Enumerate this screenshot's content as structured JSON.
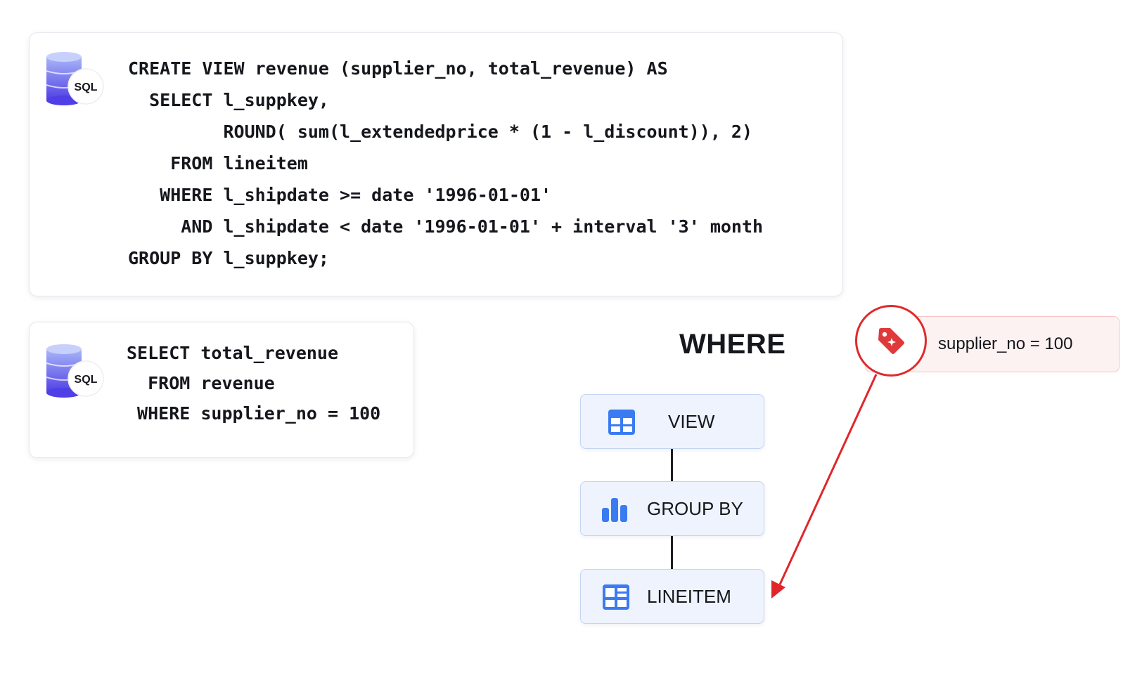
{
  "view_card": {
    "icon_label": "SQL",
    "code": "CREATE VIEW revenue (supplier_no, total_revenue) AS\n  SELECT l_suppkey,\n         ROUND( sum(l_extendedprice * (1 - l_discount)), 2)\n    FROM lineitem\n   WHERE l_shipdate >= date '1996-01-01'\n     AND l_shipdate < date '1996-01-01' + interval '3' month\nGROUP BY l_suppkey;"
  },
  "query_card": {
    "icon_label": "SQL",
    "code": "SELECT total_revenue\n  FROM revenue\n WHERE supplier_no = 100"
  },
  "diagram": {
    "heading": "WHERE",
    "nodes": [
      {
        "label": "VIEW",
        "icon": "table-icon"
      },
      {
        "label": "GROUP BY",
        "icon": "bar-chart-icon"
      },
      {
        "label": "LINEITEM",
        "icon": "table-icon"
      }
    ],
    "predicate": {
      "label": "supplier_no = 100",
      "icon": "tag-icon"
    }
  },
  "colors": {
    "accent_blue": "#3a7bf2",
    "node_fill": "#eef3fd",
    "highlight_red": "#de2a2a",
    "predicate_fill": "#fdf2f2",
    "db_purple": "#5a4fe0"
  }
}
